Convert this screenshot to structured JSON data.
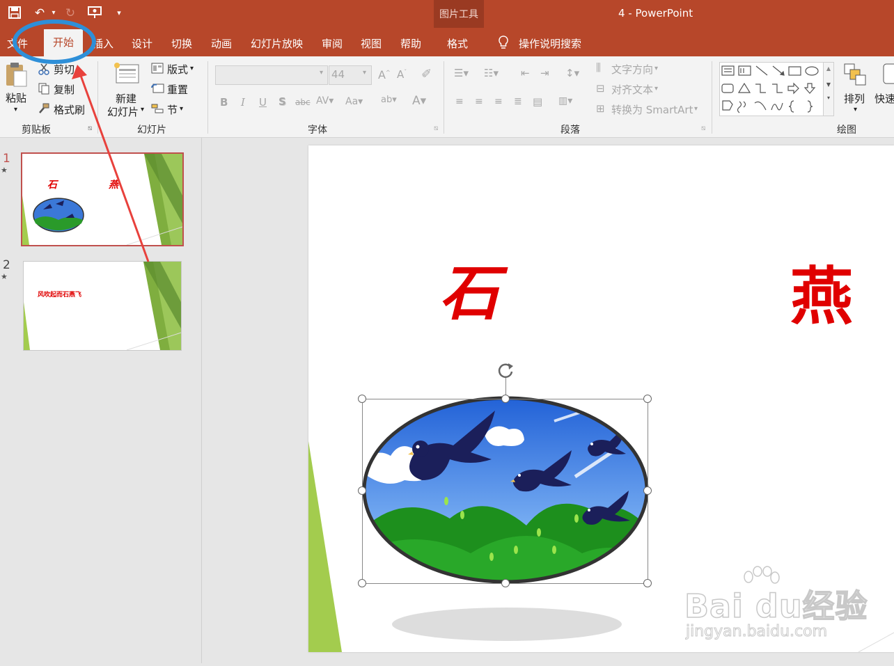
{
  "window": {
    "context_tool": "图片工具",
    "doc_title": "4  -  PowerPoint"
  },
  "tabs": [
    "文件",
    "开始",
    "插入",
    "设计",
    "切换",
    "动画",
    "幻灯片放映",
    "审阅",
    "视图",
    "帮助",
    "格式"
  ],
  "tell_me": "操作说明搜索",
  "clipboard": {
    "paste": "粘贴",
    "cut": "剪切",
    "copy": "复制",
    "format_painter": "格式刷",
    "label": "剪贴板"
  },
  "slides_group": {
    "new_line1": "新建",
    "new_line2": "幻灯片",
    "layout": "版式",
    "reset": "重置",
    "section": "节",
    "label": "幻灯片"
  },
  "font_group": {
    "size": "44",
    "label": "字体"
  },
  "paragraph_group": {
    "text_direction": "文字方向",
    "align_text": "对齐文本",
    "smartart": "转换为 SmartArt",
    "label": "段落"
  },
  "drawing_group": {
    "arrange": "排列",
    "quick": "快速",
    "label": "绘图"
  },
  "thumbnails": [
    {
      "num": "1",
      "char1": "石",
      "char2": "燕"
    },
    {
      "num": "2",
      "text": "风吹起而石燕飞"
    }
  ],
  "slide": {
    "char1": "石",
    "char2": "燕"
  },
  "watermark": {
    "brand": "Bai du经验",
    "url": "jingyan.baidu.com"
  },
  "colors": {
    "accent": "#b7472a",
    "red_text": "#e00000",
    "annotation": "#2e8fd8",
    "arrow": "#e8413c"
  }
}
